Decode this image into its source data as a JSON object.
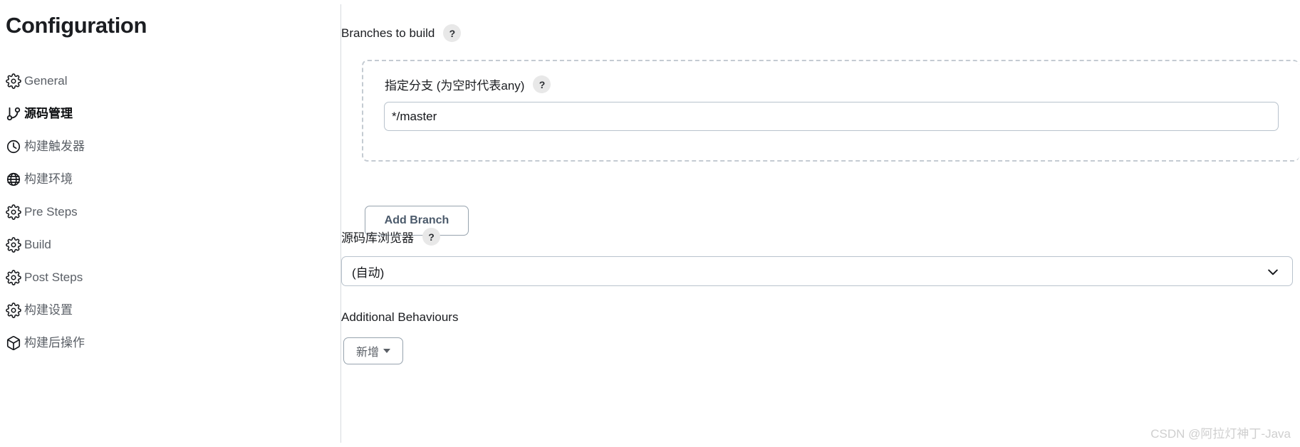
{
  "sidebar": {
    "title": "Configuration",
    "items": [
      {
        "label": "General",
        "icon": "gear-icon",
        "active": false
      },
      {
        "label": "源码管理",
        "icon": "git-branch-icon",
        "active": true
      },
      {
        "label": "构建触发器",
        "icon": "clock-icon",
        "active": false
      },
      {
        "label": "构建环境",
        "icon": "globe-icon",
        "active": false
      },
      {
        "label": "Pre Steps",
        "icon": "gear-icon",
        "active": false
      },
      {
        "label": "Build",
        "icon": "gear-icon",
        "active": false
      },
      {
        "label": "Post Steps",
        "icon": "gear-icon",
        "active": false
      },
      {
        "label": "构建设置",
        "icon": "gear-icon",
        "active": false
      },
      {
        "label": "构建后操作",
        "icon": "package-icon",
        "active": false
      }
    ]
  },
  "main": {
    "branches_to_build": {
      "label": "Branches to build",
      "help": "?",
      "branch_spec_label": "指定分支 (为空时代表any)",
      "branch_spec_help": "?",
      "branch_value": "*/master",
      "branch_placeholder": "",
      "delete_icon": "close-icon",
      "add_branch_label": "Add Branch"
    },
    "repository_browser": {
      "label": "源码库浏览器",
      "help": "?",
      "selected": "(自动)",
      "chevron_icon": "chevron-down-icon",
      "options": [
        "(自动)"
      ]
    },
    "additional_behaviours": {
      "label": "Additional Behaviours",
      "add_label": "新增",
      "caret_icon": "caret-down-icon"
    }
  },
  "watermark": "CSDN @阿拉灯神丁-Java",
  "colors": {
    "accent_danger": "#e0283c",
    "danger_bg": "#fdeaec",
    "border": "#b8c2cc",
    "dashed_border": "#c4cbd2",
    "text_primary": "#1b1d21",
    "text_muted": "#5a5f66",
    "button_text": "#4b5a6b"
  }
}
